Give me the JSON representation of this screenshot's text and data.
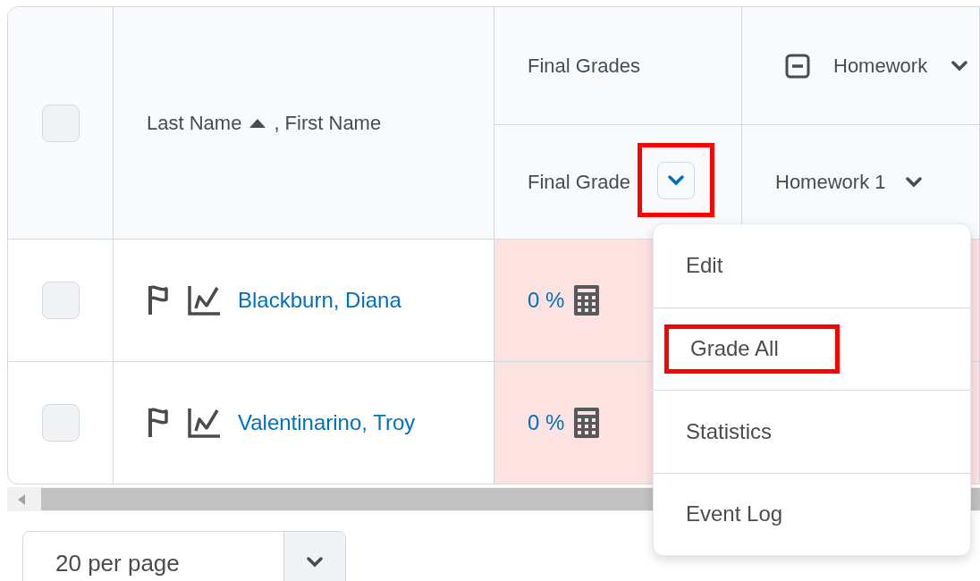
{
  "table": {
    "select_all": {
      "checked": false
    },
    "name_header": {
      "label": "Last Name",
      "sort_ascending": true,
      "suffix": ", First Name"
    },
    "groups": [
      {
        "label": "Final Grades"
      },
      {
        "label": "Homework",
        "expanded": true
      }
    ],
    "columns": [
      {
        "label": "Final Grade",
        "highlighted": true
      },
      {
        "label": "Homework 1",
        "highlighted": false
      }
    ],
    "rows": [
      {
        "checked": false,
        "name": "Blackburn, Diana",
        "grade": "0 %"
      },
      {
        "checked": false,
        "name": "Valentinarino, Troy",
        "grade": "0 %"
      }
    ]
  },
  "menu": {
    "items": [
      {
        "label": "Edit",
        "highlighted": false
      },
      {
        "label": "Grade All",
        "highlighted": true
      },
      {
        "label": "Statistics",
        "highlighted": false
      },
      {
        "label": "Event Log",
        "highlighted": false
      }
    ]
  },
  "pager": {
    "value": "20 per page"
  }
}
